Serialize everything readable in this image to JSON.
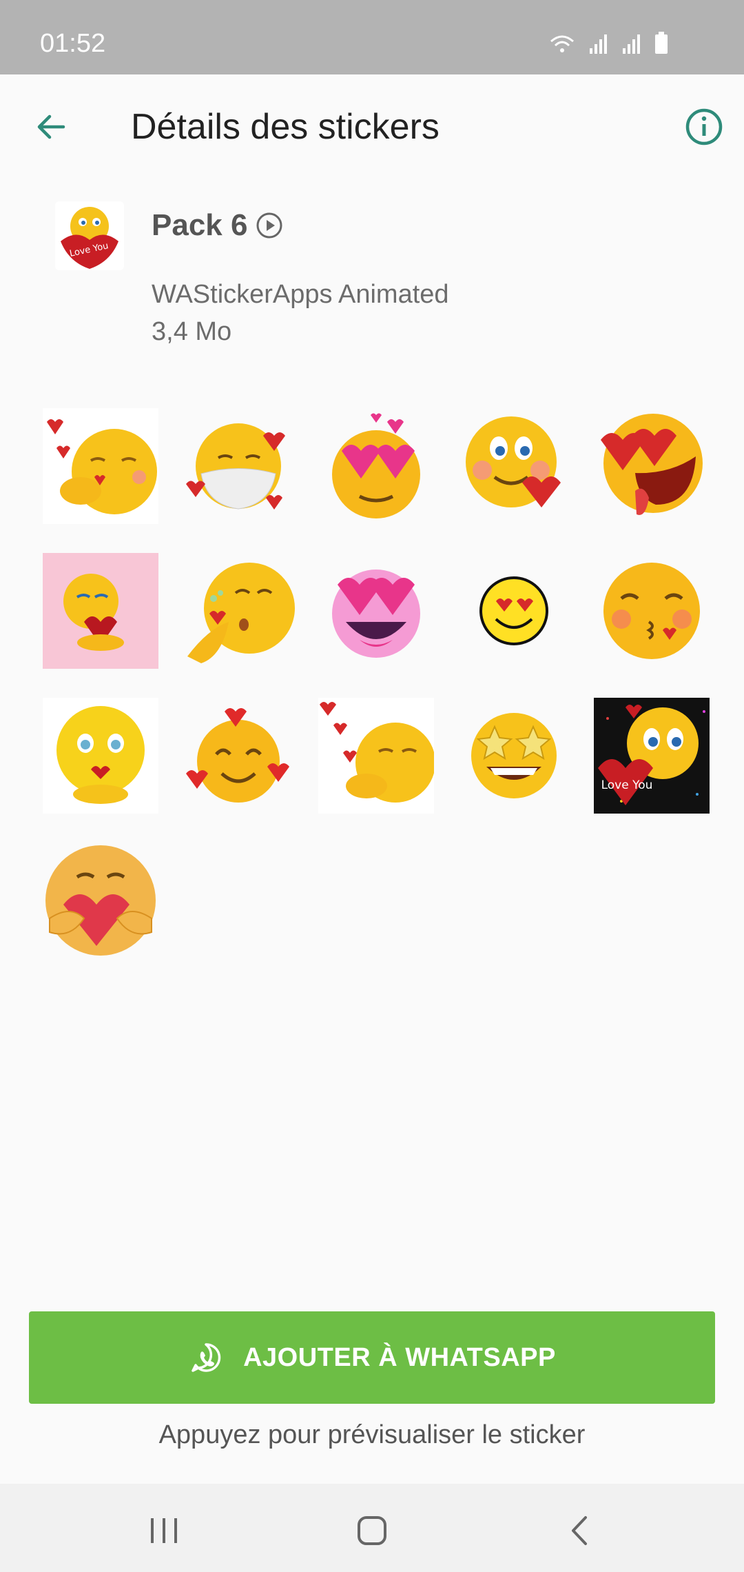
{
  "status_bar": {
    "time": "01:52"
  },
  "toolbar": {
    "title": "Détails des stickers",
    "back_icon": "arrow-left",
    "info_icon": "info-circle"
  },
  "pack": {
    "name": "Pack 6",
    "publisher": "WAStickerApps Animated",
    "size": "3,4 Mo",
    "thumb_text": "Love You"
  },
  "stickers": [
    {
      "desc": "kiss-hearts"
    },
    {
      "desc": "mask-hearts"
    },
    {
      "desc": "heart-eyes"
    },
    {
      "desc": "blush-heart"
    },
    {
      "desc": "heart-eyes-laugh"
    },
    {
      "desc": "holding-heart-pink"
    },
    {
      "desc": "blow-kiss"
    },
    {
      "desc": "pink-heart-eyes"
    },
    {
      "desc": "smiley-heart-eyes"
    },
    {
      "desc": "kissing"
    },
    {
      "desc": "kiss-lips"
    },
    {
      "desc": "smiling-hearts"
    },
    {
      "desc": "kiss-hearts-2"
    },
    {
      "desc": "star-eyes"
    },
    {
      "desc": "love-you-dark"
    },
    {
      "desc": "hug-heart"
    }
  ],
  "sticker_love_text": "Love You",
  "add_button": {
    "label": "AJOUTER À WHATSAPP",
    "color": "#6dbe45"
  },
  "hint": "Appuyez pour prévisualiser le sticker",
  "colors": {
    "accent": "#2e8b7a",
    "status_bar": "#b3b3b3"
  }
}
